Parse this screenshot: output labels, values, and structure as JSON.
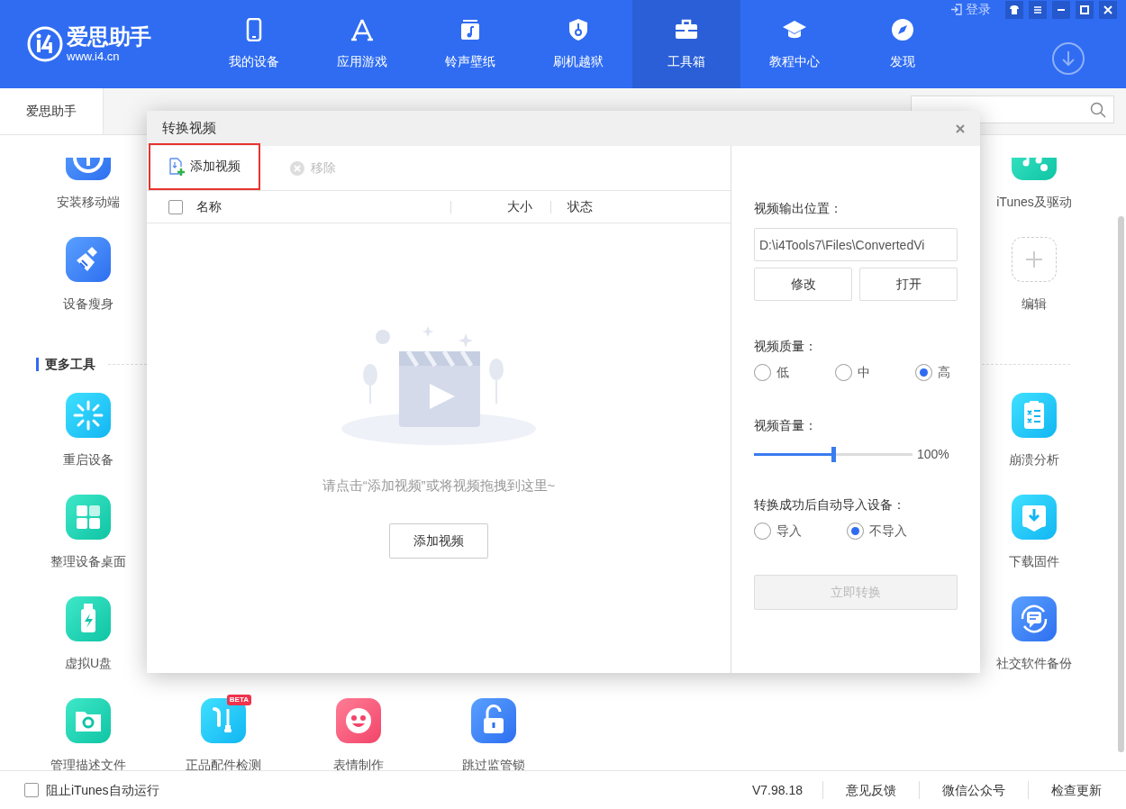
{
  "app": {
    "name": "爱思助手",
    "url": "www.i4.cn"
  },
  "nav": [
    {
      "label": "我的设备",
      "selected": false
    },
    {
      "label": "应用游戏",
      "selected": false
    },
    {
      "label": "铃声壁纸",
      "selected": false
    },
    {
      "label": "刷机越狱",
      "selected": false
    },
    {
      "label": "工具箱",
      "selected": true
    },
    {
      "label": "教程中心",
      "selected": false
    },
    {
      "label": "发现",
      "selected": false
    }
  ],
  "login": "登录",
  "tabs": [
    {
      "label": "爱思助手",
      "selected": true
    }
  ],
  "tool_sections": [
    {
      "rows": [
        {
          "left": [
            {
              "label": "安装移动端",
              "kind": "tool"
            }
          ],
          "right": [
            {
              "label": "iTunes及驱动",
              "kind": "tool"
            }
          ]
        },
        {
          "left": [
            {
              "label": "设备瘦身",
              "kind": "tool"
            }
          ],
          "right": [
            {
              "label": "编辑",
              "kind": "add"
            }
          ]
        }
      ]
    },
    {
      "title": "更多工具",
      "rows": [
        {
          "left": [
            {
              "label": "重启设备",
              "kind": "tool"
            }
          ],
          "right": [
            {
              "label": "崩溃分析",
              "kind": "tool"
            }
          ]
        },
        {
          "left": [
            {
              "label": "整理设备桌面",
              "kind": "tool"
            }
          ],
          "right": [
            {
              "label": "下载固件",
              "kind": "tool"
            }
          ]
        },
        {
          "left": [
            {
              "label": "虚拟U盘",
              "kind": "tool"
            }
          ],
          "right": [
            {
              "label": "社交软件备份",
              "kind": "tool"
            }
          ]
        },
        {
          "left": [
            {
              "label": "管理描述文件",
              "kind": "tool"
            },
            {
              "label": "正品配件检测",
              "kind": "tool",
              "badge": "BETA"
            },
            {
              "label": "表情制作",
              "kind": "tool"
            },
            {
              "label": "跳过监管锁",
              "kind": "tool"
            }
          ],
          "right": []
        }
      ]
    }
  ],
  "dialog": {
    "title": "转换视频",
    "toolbar": [
      {
        "label": "添加视频",
        "disabled": false,
        "highlighted": true
      },
      {
        "label": "移除",
        "disabled": true,
        "highlighted": false
      }
    ],
    "select_all": {
      "checked": false
    },
    "columns": [
      "名称",
      "大小",
      "状态"
    ],
    "empty_message": "请点击“添加视频”或将视频拖拽到这里~",
    "add_button": "添加视频",
    "output": {
      "label": "视频输出位置：",
      "value": "D:\\i4Tools7\\Files\\ConvertedVi",
      "change": "修改",
      "open": "打开"
    },
    "quality": {
      "label": "视频质量：",
      "options": [
        {
          "label": "低",
          "selected": false
        },
        {
          "label": "中",
          "selected": false
        },
        {
          "label": "高",
          "selected": true
        }
      ]
    },
    "volume": {
      "label": "视频音量：",
      "level": 0.5,
      "reading": "100%"
    },
    "auto_import": {
      "label": "转换成功后自动导入设备：",
      "options": [
        {
          "label": "导入",
          "selected": false
        },
        {
          "label": "不导入",
          "selected": true
        }
      ]
    },
    "convert_button": {
      "label": "立即转换",
      "disabled": true
    }
  },
  "footer": {
    "block_itunes": {
      "label": "阻止iTunes自动运行",
      "checked": false
    },
    "version": "V7.98.18",
    "links": [
      "意见反馈",
      "微信公众号",
      "检查更新"
    ]
  }
}
